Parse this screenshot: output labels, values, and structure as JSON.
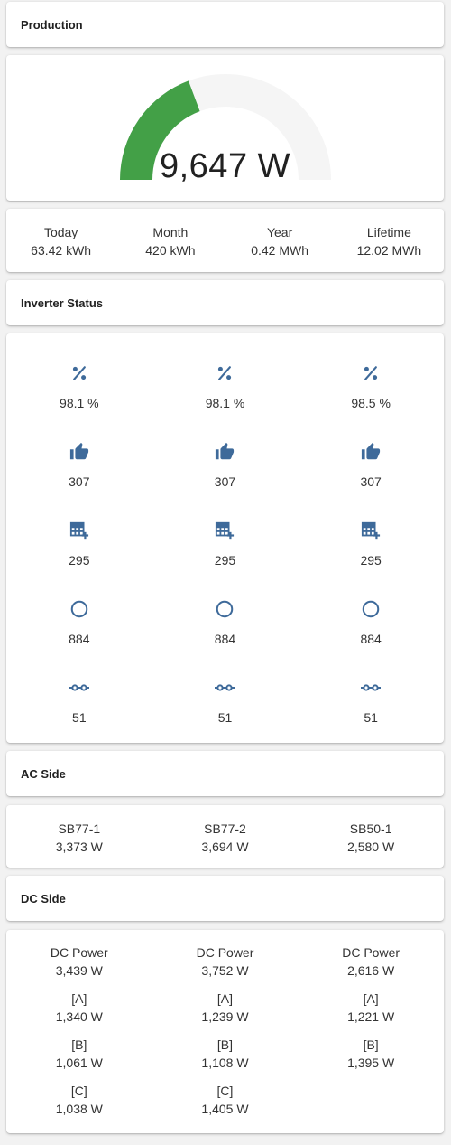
{
  "production": {
    "title": "Production",
    "gauge": {
      "value": 9647,
      "max": 25000,
      "display": "9,647 W",
      "color": "#43a047",
      "track_color": "#f5f5f5"
    },
    "stats": [
      {
        "label": "Today",
        "value": "63.42 kWh"
      },
      {
        "label": "Month",
        "value": "420 kWh"
      },
      {
        "label": "Year",
        "value": "0.42 MWh"
      },
      {
        "label": "Lifetime",
        "value": "12.02 MWh"
      }
    ]
  },
  "inverter_status": {
    "title": "Inverter Status",
    "icon_color": "#3e6a9a",
    "rows": [
      {
        "icon": "percent-icon",
        "values": [
          "98.1 %",
          "98.1 %",
          "98.5 %"
        ]
      },
      {
        "icon": "thumb-up-icon",
        "values": [
          "307",
          "307",
          "307"
        ]
      },
      {
        "icon": "table-plus-icon",
        "values": [
          "295",
          "295",
          "295"
        ]
      },
      {
        "icon": "circle-outline-icon",
        "values": [
          "884",
          "884",
          "884"
        ]
      },
      {
        "icon": "connection-icon",
        "values": [
          "51",
          "51",
          "51"
        ]
      }
    ]
  },
  "ac_side": {
    "title": "AC Side",
    "inverters": [
      {
        "name": "SB77-1",
        "power": "3,373 W"
      },
      {
        "name": "SB77-2",
        "power": "3,694 W"
      },
      {
        "name": "SB50-1",
        "power": "2,580 W"
      }
    ]
  },
  "dc_side": {
    "title": "DC Side",
    "columns": [
      [
        {
          "label": "DC Power",
          "value": "3,439 W"
        },
        {
          "label": "[A]",
          "value": "1,340 W"
        },
        {
          "label": "[B]",
          "value": "1,061 W"
        },
        {
          "label": "[C]",
          "value": "1,038 W"
        }
      ],
      [
        {
          "label": "DC Power",
          "value": "3,752 W"
        },
        {
          "label": "[A]",
          "value": "1,239 W"
        },
        {
          "label": "[B]",
          "value": "1,108 W"
        },
        {
          "label": "[C]",
          "value": "1,405 W"
        }
      ],
      [
        {
          "label": "DC Power",
          "value": "2,616 W"
        },
        {
          "label": "[A]",
          "value": "1,221 W"
        },
        {
          "label": "[B]",
          "value": "1,395 W"
        }
      ]
    ]
  }
}
